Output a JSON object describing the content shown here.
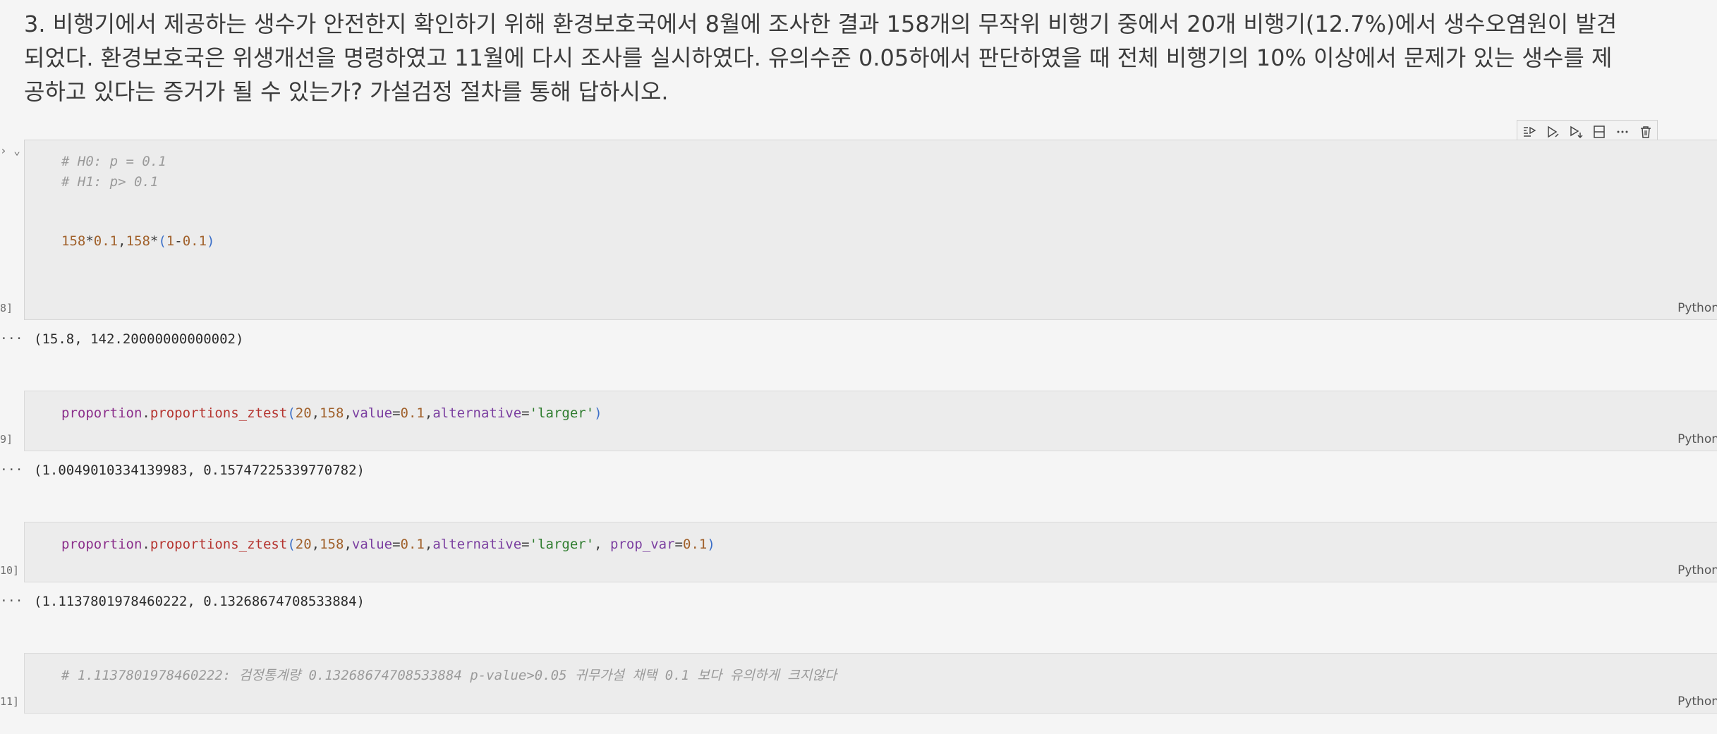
{
  "markdown": {
    "line1": "3. 비행기에서 제공하는 생수가 안전한지 확인하기 위해 환경보호국에서 8월에 조사한 결과 158개의 무작위 비행기 중에서 20개 비행기(12.7%)에서 생수오염원이 발견",
    "line2": "되었다. 환경보호국은 위생개선을 명령하였고 11월에 다시 조사를 실시하였다. 유의수준 0.05하에서 판단하였을 때 전체 비행기의 10% 이상에서 문제가 있는 생수를 제",
    "line3": "공하고 있다는 증거가 될 수 있는가? 가설검정 절차를 통해 답하시오."
  },
  "cells": [
    {
      "exec_count": "8]",
      "language": "Python",
      "code_lines": [
        "# H0: p = 0.1",
        "# H1: p> 0.1",
        "158*0.1,158*(1-0.1)"
      ],
      "output": "(15.8, 142.20000000000002)"
    },
    {
      "exec_count": "9]",
      "language": "Python",
      "code_lines": [
        "proportion.proportions_ztest(20,158,value=0.1,alternative='larger')"
      ],
      "output": "(1.0049010334139983, 0.15747225339770782)"
    },
    {
      "exec_count": "10]",
      "language": "Python",
      "code_lines": [
        "proportion.proportions_ztest(20,158,value=0.1,alternative='larger', prop_var=0.1)"
      ],
      "output": "(1.1137801978460222, 0.13268674708533884)"
    },
    {
      "exec_count": "11]",
      "language": "Python",
      "code_lines": [
        "# 1.1137801978460222: 검정통계량 0.13268674708533884 p-value>0.05 귀무가설 채택 0.1 보다 유의하게 크지않다"
      ],
      "output": ""
    }
  ],
  "output_prefix": "···",
  "cell_toolbar": {
    "icons": [
      "run-above-icon",
      "run-cell-icon",
      "run-below-icon",
      "split-cell-icon",
      "more-icon",
      "delete-icon"
    ]
  }
}
